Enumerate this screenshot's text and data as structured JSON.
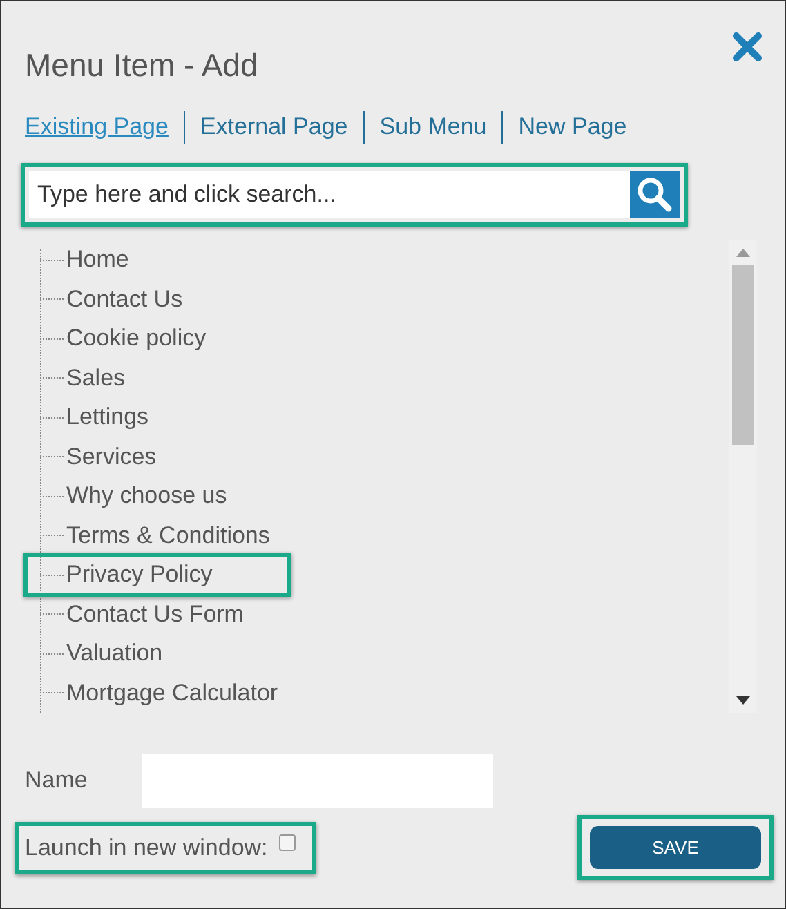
{
  "window": {
    "title": "Menu Item - Add"
  },
  "tabs": [
    {
      "label": "Existing Page",
      "selected": true
    },
    {
      "label": "External Page",
      "selected": false
    },
    {
      "label": "Sub Menu",
      "selected": false
    },
    {
      "label": "New Page",
      "selected": false
    }
  ],
  "search": {
    "placeholder": "Type here and click search...",
    "highlighted": true
  },
  "tree": {
    "items": [
      {
        "label": "Home",
        "highlighted": false
      },
      {
        "label": "Contact Us",
        "highlighted": false
      },
      {
        "label": "Cookie policy",
        "highlighted": false
      },
      {
        "label": "Sales",
        "highlighted": false
      },
      {
        "label": "Lettings",
        "highlighted": false
      },
      {
        "label": "Services",
        "highlighted": false
      },
      {
        "label": "Why choose us",
        "highlighted": false
      },
      {
        "label": "Terms & Conditions",
        "highlighted": false
      },
      {
        "label": "Privacy Policy",
        "highlighted": true
      },
      {
        "label": "Contact Us Form",
        "highlighted": false
      },
      {
        "label": "Valuation",
        "highlighted": false
      },
      {
        "label": "Mortgage Calculator",
        "highlighted": false
      }
    ]
  },
  "name_field": {
    "label": "Name"
  },
  "launch_new_window": {
    "label": "Launch in new window:",
    "checked": false,
    "highlighted": true
  },
  "save_button": {
    "label": "SAVE",
    "highlighted": true
  }
}
